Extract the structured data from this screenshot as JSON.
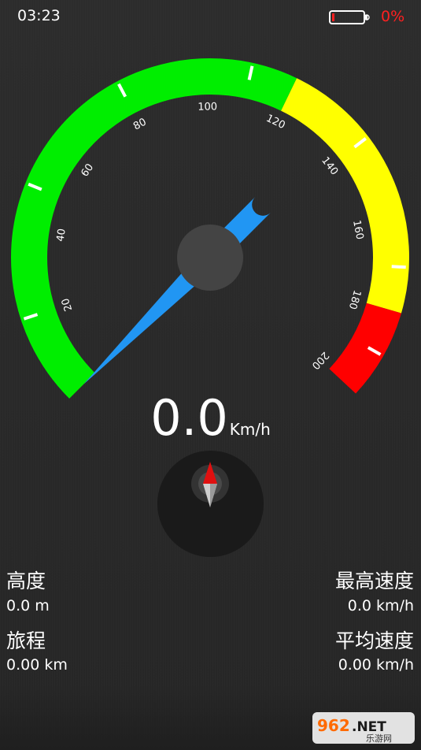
{
  "status": {
    "time": "03:23",
    "battery_percent": "0%"
  },
  "gauge": {
    "tick_labels": [
      "20",
      "40",
      "60",
      "80",
      "100",
      "120",
      "140",
      "160",
      "180",
      "200"
    ],
    "needle_value": 0,
    "colors": {
      "green": "#00ee00",
      "yellow": "#ffff00",
      "red": "#ff0000",
      "needle": "#2196f3"
    }
  },
  "speed": {
    "value": "0.0",
    "unit": "Km/h"
  },
  "info": {
    "altitude_label": "高度",
    "altitude_value": "0.0 m",
    "max_speed_label": "最高速度",
    "max_speed_value": "0.0 km/h",
    "distance_label": "旅程",
    "distance_value": "0.00 km",
    "avg_speed_label": "平均速度",
    "avg_speed_value": "0.00 km/h"
  },
  "watermark": {
    "logo": "962.NET",
    "text": "乐游网"
  }
}
